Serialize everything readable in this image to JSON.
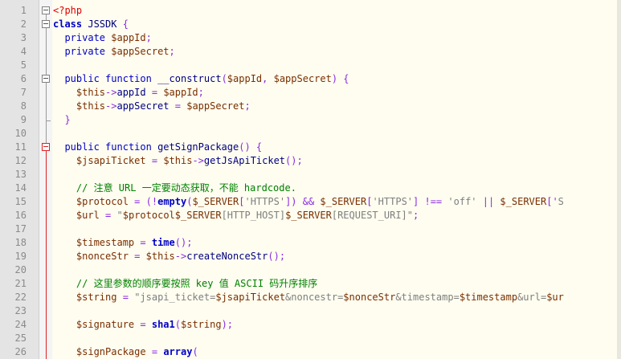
{
  "editor": {
    "colors": {
      "background": "#fefdf0",
      "gutter": "#e4e4e4",
      "php_tag": "#e00000",
      "keyword": "#0000c8",
      "identifier": "#000080",
      "variable": "#7a2e00",
      "operator": "#8a2be2",
      "string": "#7f7f7f",
      "comment": "#008000",
      "fold_marker_active": "#dd2222"
    },
    "lines": [
      {
        "n": "1",
        "fold": "box",
        "tokens": [
          [
            "tag",
            "<?php"
          ]
        ]
      },
      {
        "n": "2",
        "fold": "box",
        "tokens": [
          [
            "kwb",
            "class"
          ],
          [
            "plain",
            " JSSDK "
          ],
          [
            "op",
            "{"
          ]
        ]
      },
      {
        "n": "3",
        "fold": "line",
        "tokens": [
          [
            "plain",
            "  "
          ],
          [
            "kw",
            "private"
          ],
          [
            "plain",
            " "
          ],
          [
            "var",
            "$appId"
          ],
          [
            "op",
            ";"
          ]
        ]
      },
      {
        "n": "4",
        "fold": "line",
        "tokens": [
          [
            "plain",
            "  "
          ],
          [
            "kw",
            "private"
          ],
          [
            "plain",
            " "
          ],
          [
            "var",
            "$appSecret"
          ],
          [
            "op",
            ";"
          ]
        ]
      },
      {
        "n": "5",
        "fold": "line",
        "tokens": []
      },
      {
        "n": "6",
        "fold": "box",
        "tokens": [
          [
            "plain",
            "  "
          ],
          [
            "kw",
            "public"
          ],
          [
            "plain",
            " "
          ],
          [
            "kw",
            "function"
          ],
          [
            "plain",
            " "
          ],
          [
            "fn",
            "__construct"
          ],
          [
            "op",
            "("
          ],
          [
            "var",
            "$appId"
          ],
          [
            "op",
            ", "
          ],
          [
            "var",
            "$appSecret"
          ],
          [
            "op",
            ") {"
          ]
        ]
      },
      {
        "n": "7",
        "fold": "line",
        "tokens": [
          [
            "plain",
            "    "
          ],
          [
            "var",
            "$this"
          ],
          [
            "op",
            "->"
          ],
          [
            "fn",
            "appId"
          ],
          [
            "plain",
            " "
          ],
          [
            "op",
            "="
          ],
          [
            "plain",
            " "
          ],
          [
            "var",
            "$appId"
          ],
          [
            "op",
            ";"
          ]
        ]
      },
      {
        "n": "8",
        "fold": "line",
        "tokens": [
          [
            "plain",
            "    "
          ],
          [
            "var",
            "$this"
          ],
          [
            "op",
            "->"
          ],
          [
            "fn",
            "appSecret"
          ],
          [
            "plain",
            " "
          ],
          [
            "op",
            "="
          ],
          [
            "plain",
            " "
          ],
          [
            "var",
            "$appSecret"
          ],
          [
            "op",
            ";"
          ]
        ]
      },
      {
        "n": "9",
        "fold": "end",
        "tokens": [
          [
            "plain",
            "  "
          ],
          [
            "op",
            "}"
          ]
        ]
      },
      {
        "n": "10",
        "fold": "line",
        "tokens": []
      },
      {
        "n": "11",
        "fold": "boxred",
        "tokens": [
          [
            "plain",
            "  "
          ],
          [
            "kw",
            "public"
          ],
          [
            "plain",
            " "
          ],
          [
            "kw",
            "function"
          ],
          [
            "plain",
            " "
          ],
          [
            "fn",
            "getSignPackage"
          ],
          [
            "op",
            "() {"
          ]
        ]
      },
      {
        "n": "12",
        "fold": "red",
        "tokens": [
          [
            "plain",
            "    "
          ],
          [
            "var",
            "$jsapiTicket"
          ],
          [
            "plain",
            " "
          ],
          [
            "op",
            "="
          ],
          [
            "plain",
            " "
          ],
          [
            "var",
            "$this"
          ],
          [
            "op",
            "->"
          ],
          [
            "fn",
            "getJsApiTicket"
          ],
          [
            "op",
            "();"
          ]
        ]
      },
      {
        "n": "13",
        "fold": "red",
        "tokens": []
      },
      {
        "n": "14",
        "fold": "red",
        "tokens": [
          [
            "plain",
            "    "
          ],
          [
            "cm",
            "// 注意 URL 一定要动态获取，不能 hardcode."
          ]
        ]
      },
      {
        "n": "15",
        "fold": "red",
        "tokens": [
          [
            "plain",
            "    "
          ],
          [
            "var",
            "$protocol"
          ],
          [
            "plain",
            " "
          ],
          [
            "op",
            "="
          ],
          [
            "plain",
            " "
          ],
          [
            "op",
            "(!"
          ],
          [
            "kwb",
            "empty"
          ],
          [
            "op",
            "("
          ],
          [
            "var",
            "$_SERVER"
          ],
          [
            "op",
            "["
          ],
          [
            "str",
            "'HTTPS'"
          ],
          [
            "op",
            "]) && "
          ],
          [
            "var",
            "$_SERVER"
          ],
          [
            "op",
            "["
          ],
          [
            "str",
            "'HTTPS'"
          ],
          [
            "op",
            "] !== "
          ],
          [
            "str",
            "'off'"
          ],
          [
            "op",
            " || "
          ],
          [
            "var",
            "$_SERVER"
          ],
          [
            "op",
            "['"
          ],
          [
            "str",
            "S"
          ]
        ]
      },
      {
        "n": "16",
        "fold": "red",
        "tokens": [
          [
            "plain",
            "    "
          ],
          [
            "var",
            "$url"
          ],
          [
            "plain",
            " "
          ],
          [
            "op",
            "="
          ],
          [
            "plain",
            " "
          ],
          [
            "str",
            "\""
          ],
          [
            "var",
            "$protocol$_SERVER"
          ],
          [
            "str",
            "[HTTP_HOST]"
          ],
          [
            "var",
            "$_SERVER"
          ],
          [
            "str",
            "[REQUEST_URI]\""
          ],
          [
            "op",
            ";"
          ]
        ]
      },
      {
        "n": "17",
        "fold": "red",
        "tokens": []
      },
      {
        "n": "18",
        "fold": "red",
        "tokens": [
          [
            "plain",
            "    "
          ],
          [
            "var",
            "$timestamp"
          ],
          [
            "plain",
            " "
          ],
          [
            "op",
            "="
          ],
          [
            "plain",
            " "
          ],
          [
            "kwb",
            "time"
          ],
          [
            "op",
            "();"
          ]
        ]
      },
      {
        "n": "19",
        "fold": "red",
        "tokens": [
          [
            "plain",
            "    "
          ],
          [
            "var",
            "$nonceStr"
          ],
          [
            "plain",
            " "
          ],
          [
            "op",
            "="
          ],
          [
            "plain",
            " "
          ],
          [
            "var",
            "$this"
          ],
          [
            "op",
            "->"
          ],
          [
            "fn",
            "createNonceStr"
          ],
          [
            "op",
            "();"
          ]
        ]
      },
      {
        "n": "20",
        "fold": "red",
        "tokens": []
      },
      {
        "n": "21",
        "fold": "red",
        "tokens": [
          [
            "plain",
            "    "
          ],
          [
            "cm",
            "// 这里参数的顺序要按照 key 值 ASCII 码升序排序"
          ]
        ]
      },
      {
        "n": "22",
        "fold": "red",
        "tokens": [
          [
            "plain",
            "    "
          ],
          [
            "var",
            "$string"
          ],
          [
            "plain",
            " "
          ],
          [
            "op",
            "="
          ],
          [
            "plain",
            " "
          ],
          [
            "str",
            "\"jsapi_ticket="
          ],
          [
            "var",
            "$jsapiTicket"
          ],
          [
            "str",
            "&noncestr="
          ],
          [
            "var",
            "$nonceStr"
          ],
          [
            "str",
            "&timestamp="
          ],
          [
            "var",
            "$timestamp"
          ],
          [
            "str",
            "&url="
          ],
          [
            "var",
            "$ur"
          ]
        ]
      },
      {
        "n": "23",
        "fold": "red",
        "tokens": []
      },
      {
        "n": "24",
        "fold": "red",
        "tokens": [
          [
            "plain",
            "    "
          ],
          [
            "var",
            "$signature"
          ],
          [
            "plain",
            " "
          ],
          [
            "op",
            "="
          ],
          [
            "plain",
            " "
          ],
          [
            "kwb",
            "sha1"
          ],
          [
            "op",
            "("
          ],
          [
            "var",
            "$string"
          ],
          [
            "op",
            ");"
          ]
        ]
      },
      {
        "n": "25",
        "fold": "red",
        "tokens": []
      },
      {
        "n": "26",
        "fold": "red",
        "tokens": [
          [
            "plain",
            "    "
          ],
          [
            "var",
            "$signPackage"
          ],
          [
            "plain",
            " "
          ],
          [
            "op",
            "="
          ],
          [
            "plain",
            " "
          ],
          [
            "kwb",
            "array"
          ],
          [
            "op",
            "("
          ]
        ]
      }
    ]
  }
}
